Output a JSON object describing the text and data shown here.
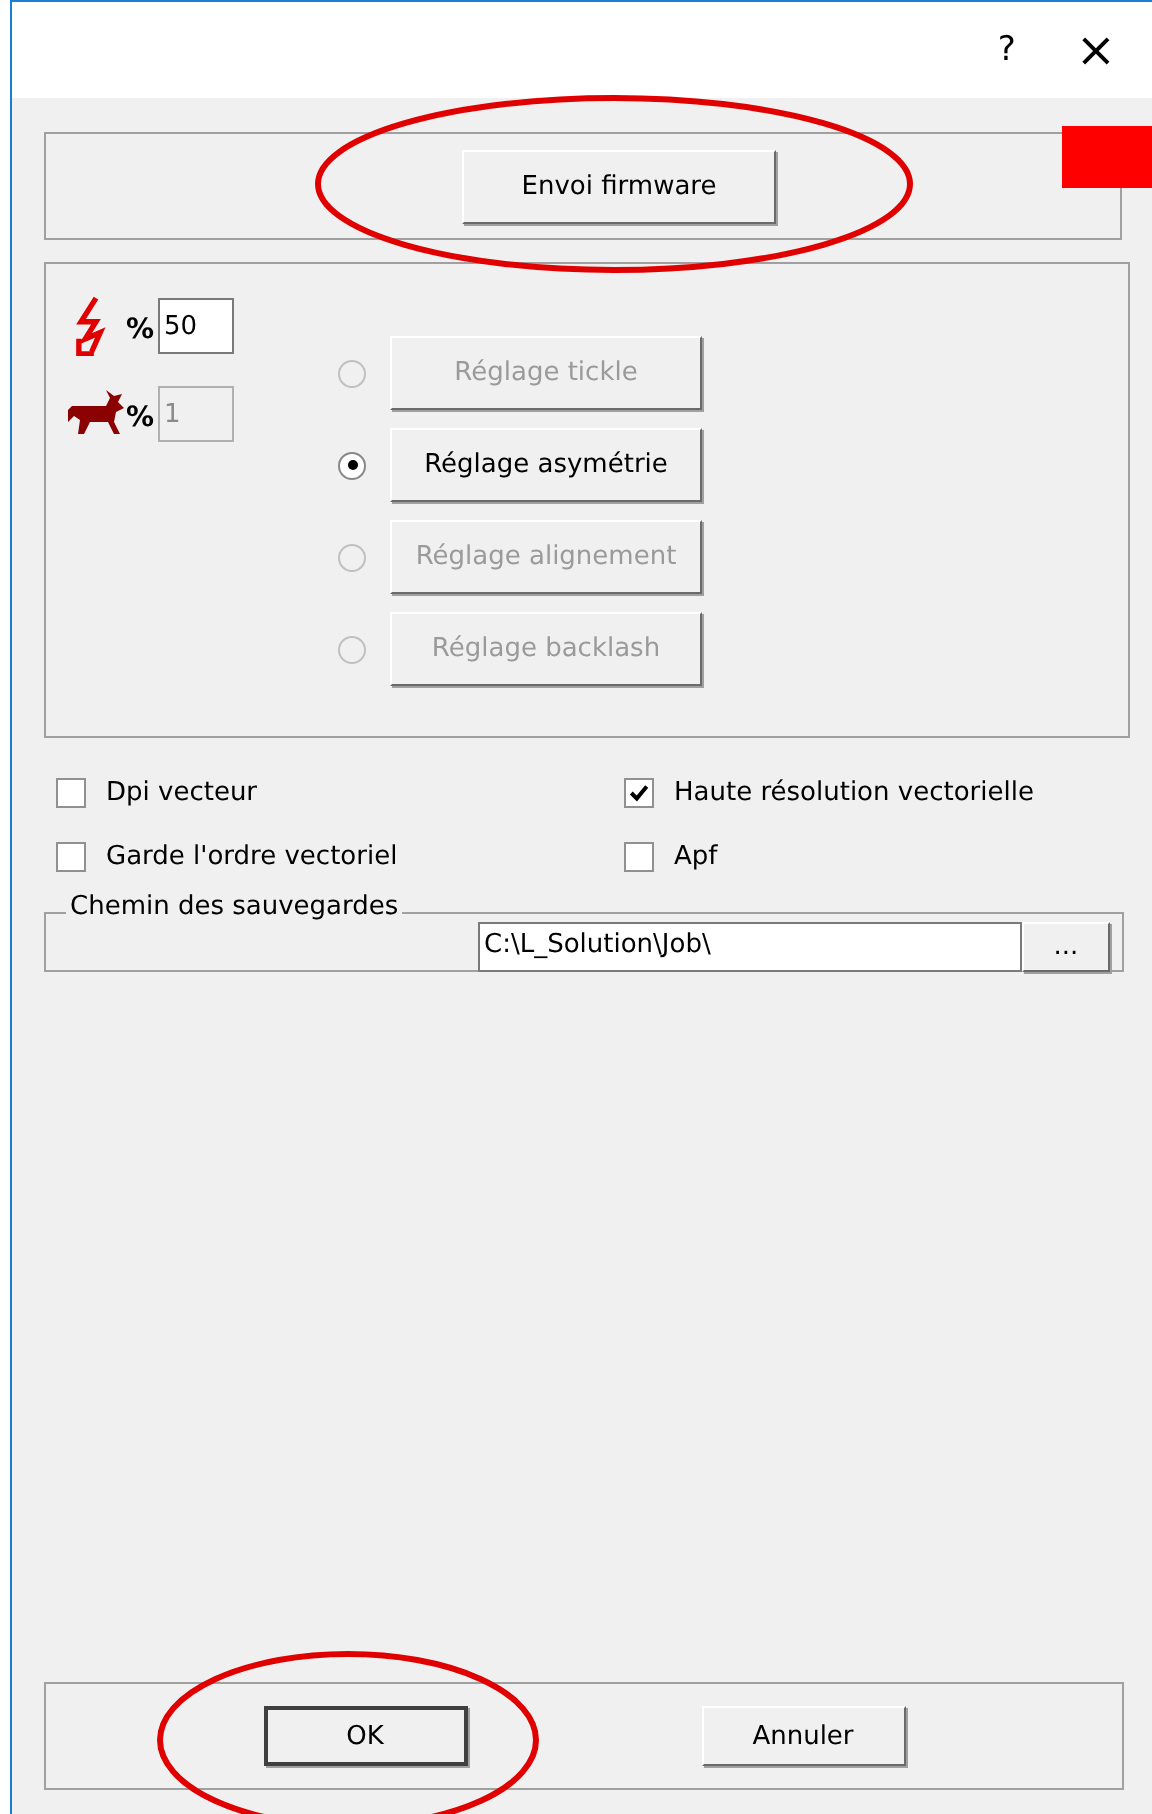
{
  "title_bar": {
    "help": "?",
    "close": "×"
  },
  "firmware_button": {
    "label": "Envoi firmware"
  },
  "level_fields": [
    {
      "kind": "lightning",
      "percent": "%",
      "value": "50",
      "disabled": false
    },
    {
      "kind": "deer",
      "percent": "%",
      "value": "1",
      "disabled": true
    }
  ],
  "adjust_options": [
    {
      "label": "Réglage tickle",
      "selected": false,
      "disabled": true
    },
    {
      "label": "Réglage asymétrie",
      "selected": true,
      "disabled": false
    },
    {
      "label": "Réglage alignement",
      "selected": false,
      "disabled": true
    },
    {
      "label": "Réglage backlash",
      "selected": false,
      "disabled": true
    }
  ],
  "checkboxes": [
    {
      "label": "Dpi vecteur",
      "checked": false
    },
    {
      "label": "Haute résolution vectorielle",
      "checked": true
    },
    {
      "label": "Garde l'ordre vectoriel",
      "checked": false
    },
    {
      "label": "Apf",
      "checked": false
    }
  ],
  "save_path": {
    "legend": "Chemin des sauvegardes",
    "value": "C:\\L_Solution\\Job\\",
    "browse": "..."
  },
  "buttons": [
    {
      "label": "OK",
      "default": true
    },
    {
      "label": "Annuler",
      "default": false
    }
  ]
}
